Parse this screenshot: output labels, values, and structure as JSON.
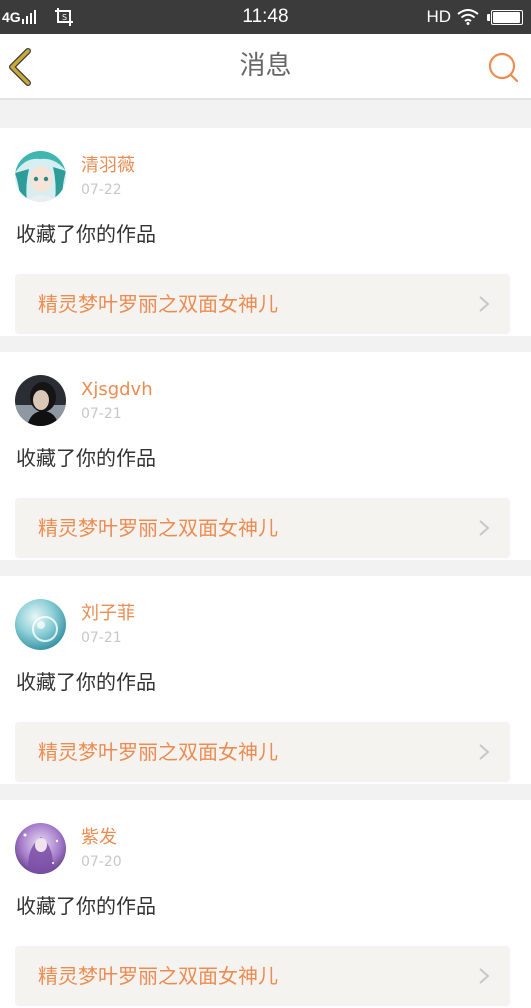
{
  "status_bar": {
    "network": "4G",
    "time": "11:48",
    "hd": "HD",
    "icons": [
      "signal-icon",
      "screenshot-icon",
      "wifi-icon",
      "battery-icon"
    ]
  },
  "header": {
    "title": "消息",
    "back_icon": "back-arrow-icon",
    "search_icon": "search-icon",
    "accent_color": "#ec8c52",
    "back_color": "#c9a93a"
  },
  "messages": [
    {
      "username": "清羽薇",
      "date": "07-22",
      "action": "收藏了你的作品",
      "work_title": "精灵梦叶罗丽之双面女神儿"
    },
    {
      "username": "Xjsgdvh",
      "date": "07-21",
      "action": "收藏了你的作品",
      "work_title": "精灵梦叶罗丽之双面女神儿"
    },
    {
      "username": "刘子菲",
      "date": "07-21",
      "action": "收藏了你的作品",
      "work_title": "精灵梦叶罗丽之双面女神儿"
    },
    {
      "username": "紫发",
      "date": "07-20",
      "action": "收藏了你的作品",
      "work_title": "精灵梦叶罗丽之双面女神儿"
    }
  ]
}
